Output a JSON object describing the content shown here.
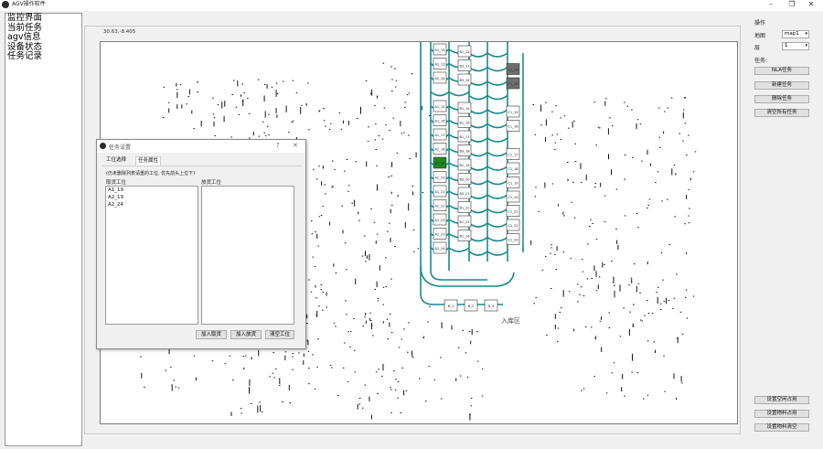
{
  "window": {
    "title": "AGV操作软件",
    "minimize": "–",
    "maximize": "❐",
    "close": "✕"
  },
  "sidebar": {
    "items": [
      {
        "label": "监控界面"
      },
      {
        "label": "当前任务"
      },
      {
        "label": "agv信息"
      },
      {
        "label": "设备状态"
      },
      {
        "label": "任务记录"
      }
    ]
  },
  "map": {
    "coordinates": "30.63,-8.405",
    "area_label": "入库区",
    "nodes": {
      "col_a": [
        "A1_13",
        "A2_13",
        "A2_14",
        "A1_15",
        "A1_16",
        "A1_17",
        "A2_18",
        "A1_19",
        "A2_20",
        "A1_21",
        "A2_22",
        "A1_23",
        "A2_23",
        "A2_24"
      ],
      "col_b": [
        "B1_13",
        "B3_13",
        "B3_14",
        "B1_15",
        "B1_16",
        "B1_17",
        "B3_18",
        "B1_19",
        "B3_20",
        "B3_21",
        "B1_22",
        "B1_23",
        "B1_24"
      ],
      "col_c": [
        "C1_13",
        "C1_14",
        "C1_15",
        "C1_16",
        "C1_17",
        "C1_18",
        "C1_19",
        "C1_20",
        "C1_21",
        "C1_22",
        "C1_23"
      ],
      "entry": [
        "B_1",
        "B_2",
        "B_3"
      ]
    },
    "highlight_color": "#1c8a1c",
    "occupied_color": "#6e6e6e",
    "track_color": "#1b8a8a"
  },
  "right_panel": {
    "section_label": "操作",
    "map_label": "地图",
    "map_value": "map1",
    "layer_label": "层",
    "layer_value": "1",
    "task_label": "任务:",
    "buttons": [
      {
        "label": "NLA任务"
      },
      {
        "label": "新建任务"
      },
      {
        "label": "删除任务"
      },
      {
        "label": "清空所有任务"
      }
    ],
    "bottom_buttons": [
      {
        "label": "设置空闲占用"
      },
      {
        "label": "设置物料占用"
      },
      {
        "label": "设置物料清空"
      }
    ]
  },
  "dialog": {
    "title": "任务设置",
    "help": "?",
    "close": "✕",
    "tabs": [
      {
        "label": "工位选择"
      },
      {
        "label": "任务属性"
      }
    ],
    "hint": "(仍未删除列表请重的工位, 优先前头上位下)",
    "left_list_label": "取货工位",
    "right_list_label": "放货工位",
    "left_items": [
      "A1_19",
      "A2_19",
      "A2_24"
    ],
    "right_items": [],
    "buttons": [
      {
        "label": "加入取货"
      },
      {
        "label": "加入放货"
      },
      {
        "label": "清空工位"
      }
    ]
  }
}
